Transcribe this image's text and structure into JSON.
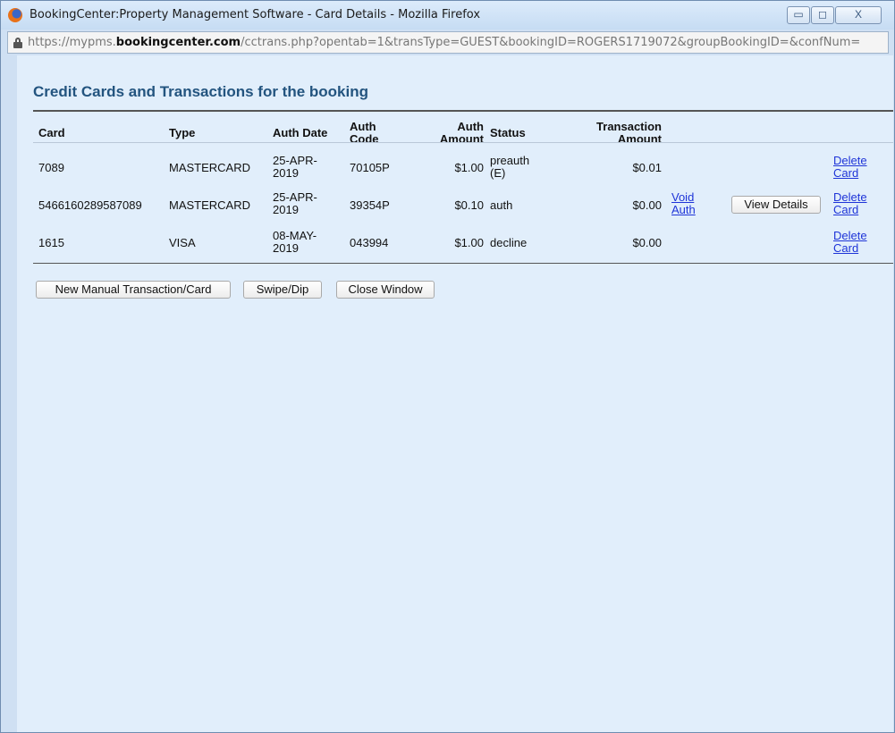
{
  "window": {
    "title": "BookingCenter:Property Management Software - Card Details - Mozilla Firefox",
    "min_symbol": "▭",
    "max_symbol": "◻",
    "close_symbol": "X",
    "url_prefix": "https://mypms.",
    "url_host": "bookingcenter.com",
    "url_path": "/cctrans.php?opentab=1&transType=GUEST&bookingID=ROGERS1719072&groupBookingID=&confNum="
  },
  "heading": "Credit Cards and Transactions for the booking",
  "table": {
    "headers": {
      "card": "Card",
      "type": "Type",
      "auth_date": "Auth Date",
      "auth_code_1": "Auth",
      "auth_code_2": "Code",
      "auth_amount_1": "Auth",
      "auth_amount_2": "Amount",
      "status": "Status",
      "trans_amount_1": "Transaction",
      "trans_amount_2": "Amount"
    },
    "rows": [
      {
        "card": "7089",
        "type": "MASTERCARD",
        "auth_date_1": "25-APR-",
        "auth_date_2": "2019",
        "auth_code": "70105P",
        "auth_amount": "$1.00",
        "status_1": "preauth",
        "status_2": "(E)",
        "trans_amount": "$0.01",
        "delete_1": "Delete",
        "delete_2": "Card"
      },
      {
        "card": "5466160289587089",
        "type": "MASTERCARD",
        "auth_date_1": "25-APR-",
        "auth_date_2": "2019",
        "auth_code": "39354P",
        "auth_amount": "$0.10",
        "status_1": "auth",
        "trans_amount": "$0.00",
        "void_1": "Void",
        "void_2": "Auth",
        "view_details": "View Details",
        "delete_1": "Delete",
        "delete_2": "Card"
      },
      {
        "card": "1615",
        "type": "VISA",
        "auth_date_1": "08-MAY-",
        "auth_date_2": "2019",
        "auth_code": "043994",
        "auth_amount": "$1.00",
        "status_1": "decline",
        "trans_amount": "$0.00",
        "delete_1": "Delete",
        "delete_2": "Card"
      }
    ]
  },
  "buttons": {
    "new_manual": "New Manual Transaction/Card",
    "swipe": "Swipe/Dip",
    "close": "Close Window"
  }
}
